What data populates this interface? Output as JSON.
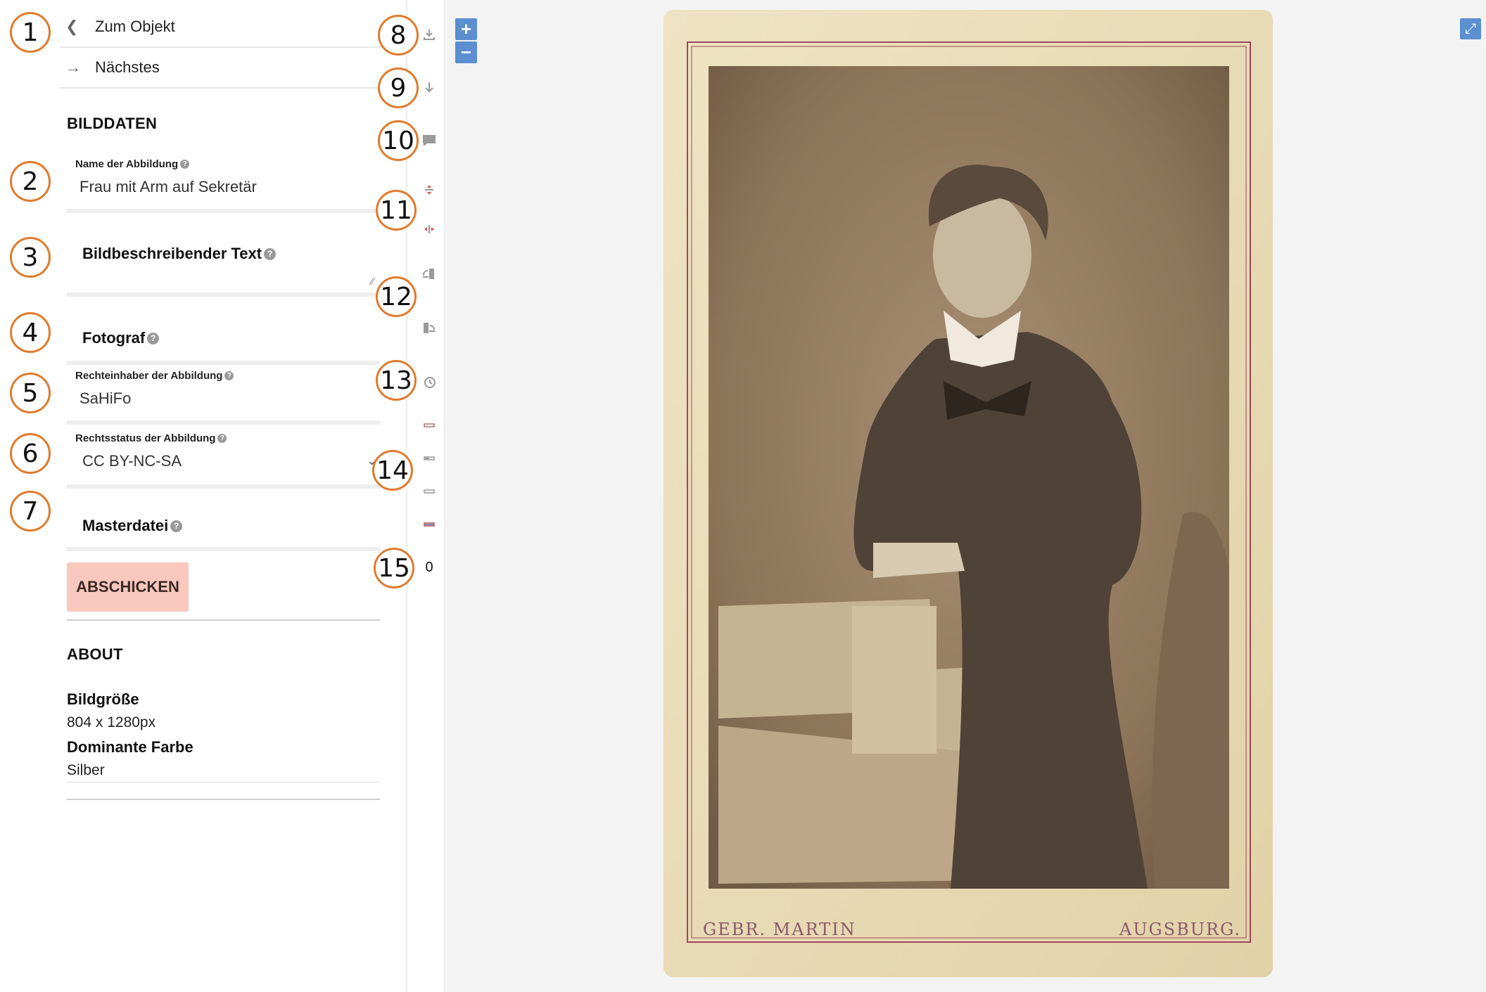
{
  "nav": {
    "back_label": "Zum Objekt",
    "next_label": "Nächstes"
  },
  "bilddaten": {
    "title": "BILDDATEN",
    "name_label": "Name der Abbildung",
    "name_value": "Frau mit Arm auf Sekretär",
    "beschreibung_label": "Bildbeschreibender Text",
    "fotograf_label": "Fotograf",
    "rechteinhaber_label": "Rechteinhaber der Abbildung",
    "rechteinhaber_value": "SaHiFo",
    "rechtsstatus_label": "Rechtsstatus der Abbildung",
    "rechtsstatus_value": "CC BY-NC-SA",
    "masterdatei_label": "Masterdatei",
    "submit_label": "ABSCHICKEN"
  },
  "about": {
    "title": "ABOUT",
    "size_label": "Bildgröße",
    "size_value": "804 x 1280px",
    "color_label": "Dominante Farbe",
    "color_value": "Silber"
  },
  "tools": {
    "counter": "0",
    "icons": [
      "download-icon",
      "arrow-down-icon",
      "comment-icon",
      "flip-vertical-icon",
      "flip-horizontal-icon",
      "rotate-left-icon",
      "rotate-right-icon",
      "history-icon",
      "filter-icon",
      "filter-icon",
      "filter-icon",
      "filter-icon"
    ]
  },
  "viewer": {
    "zoom_in": "+",
    "zoom_out": "−",
    "fullscreen": "⤢",
    "photo_caption_left": "GEBR. MARTIN",
    "photo_caption_right": "AUGSBURG."
  },
  "callouts": [
    "1",
    "2",
    "3",
    "4",
    "5",
    "6",
    "7",
    "8",
    "9",
    "10",
    "11",
    "12",
    "13",
    "14",
    "15"
  ],
  "colors": {
    "accent": "#5b8fd0",
    "callout_border": "#e07b2e",
    "submit_bg": "#f8c8bd",
    "card_bg": "#e9dcb8",
    "photo_sepia": "#9a8266"
  }
}
